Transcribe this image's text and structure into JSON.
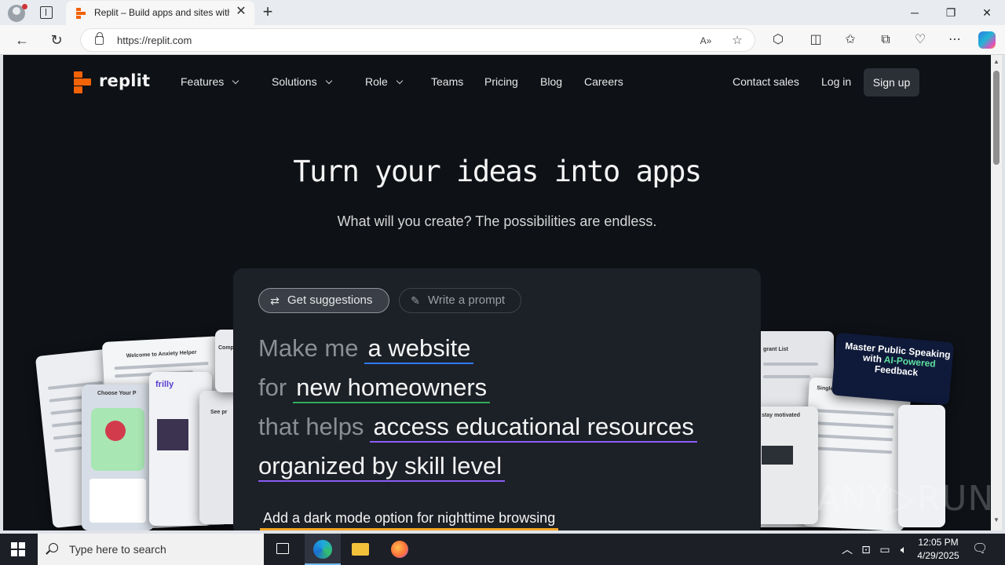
{
  "browser": {
    "tab_title": "Replit – Build apps and sites with",
    "url": "https://replit.com",
    "new_tab": "+",
    "tab_close": "✕",
    "window_controls": {
      "minimize": "─",
      "restore": "❐",
      "close": "✕"
    }
  },
  "nav": {
    "logo_text": "replit",
    "items": [
      {
        "label": "Features",
        "dropdown": true
      },
      {
        "label": "Solutions",
        "dropdown": true
      },
      {
        "label": "Role",
        "dropdown": true
      },
      {
        "label": "Teams",
        "dropdown": false
      },
      {
        "label": "Pricing",
        "dropdown": false
      },
      {
        "label": "Blog",
        "dropdown": false
      },
      {
        "label": "Careers",
        "dropdown": false
      }
    ],
    "contact_sales": "Contact sales",
    "log_in": "Log in",
    "sign_up": "Sign up"
  },
  "hero": {
    "title": "Turn your ideas into apps",
    "subtitle": "What will you create? The possibilities are endless."
  },
  "prompt_panel": {
    "chip_suggestions": "Get suggestions",
    "chip_write": "Write a prompt",
    "line1_prefix": "Make me",
    "line1_value": "a website",
    "line2_prefix": "for",
    "line2_value": "new homeowners",
    "line3_prefix": "that helps",
    "line3_value": "access educational resources",
    "line4_value": "organized by skill level",
    "extra_feature": "Add a dark mode option for nighttime browsing"
  },
  "collage": {
    "left_cards": [
      "Welcome to Anxiety Helper",
      "Choose Your P",
      "frilly",
      "See pr",
      "Comp"
    ],
    "right_cards": [
      "grant List",
      "Single Property Loan Calculator",
      "stay motivated"
    ],
    "speaking_card": {
      "title_line1": "Master Public Speaking",
      "title_line2_prefix": "with",
      "title_line2_accent": "AI-Powered",
      "title_line3": "Feedback"
    }
  },
  "watermark": "ANY▷RUN",
  "taskbar": {
    "search_placeholder": "Type here to search",
    "time": "12:05 PM",
    "date": "4/29/2025"
  },
  "colors": {
    "page_bg": "#0e1116",
    "panel_bg": "#1c2027",
    "replit_orange": "#f26207",
    "underline_blue": "#2f7af8",
    "underline_green": "#2fae5b",
    "underline_purple": "#8b5cf6",
    "underline_orange": "#f5a524"
  }
}
